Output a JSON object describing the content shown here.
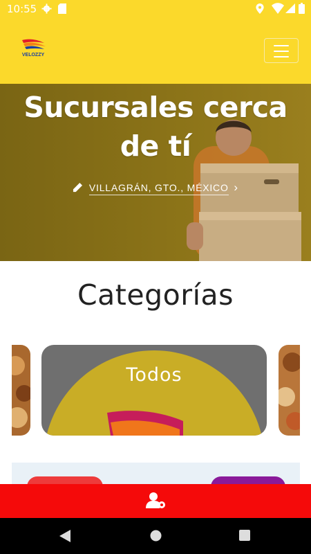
{
  "status_bar": {
    "time": "10:55",
    "icons": [
      "settings-icon",
      "sd-card-icon",
      "location-icon",
      "wifi-icon",
      "signal-icon",
      "battery-icon"
    ]
  },
  "header": {
    "logo_text": "VELOZZY",
    "menu_icon": "hamburger-menu-icon"
  },
  "hero": {
    "title": "Sucursales cerca de tí",
    "location": "VILLAGRÁN, GTO., MÉXICO",
    "edit_icon": "pencil-icon",
    "chevron": "›"
  },
  "categories": {
    "heading": "Categorías",
    "items": [
      {
        "label": "Todos"
      }
    ]
  },
  "bottom_bar": {
    "icon": "user-gear-icon"
  },
  "nav": {
    "icons": [
      "back-icon",
      "home-icon",
      "recents-icon"
    ]
  },
  "colors": {
    "brand_yellow": "#fbd92b",
    "bottom_red": "#f50a0a",
    "hero_overlay": "#8b7318"
  }
}
